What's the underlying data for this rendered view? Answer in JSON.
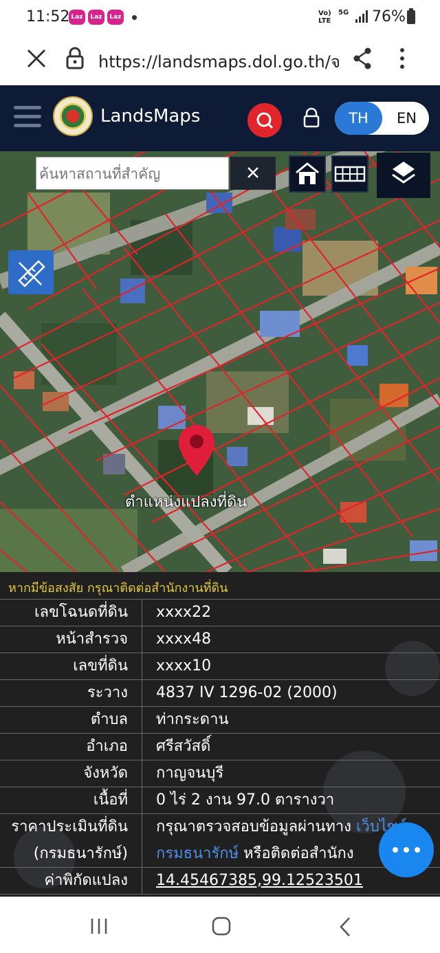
{
  "status": {
    "time": "11:52",
    "volte": "Vo) LTE",
    "network": "5G",
    "battery": "76%"
  },
  "browser": {
    "url": "https://landsmaps.dol.go.th/จ"
  },
  "header": {
    "brand": "LandsMaps",
    "lang_th": "TH",
    "lang_en": "EN"
  },
  "map": {
    "search_placeholder": "ค้นหาสถานที่สำคัญ",
    "pin_label": "ตำแหน่งแปลงที่ดิน"
  },
  "info": {
    "notice": "หากมีข้อสงสัย กรุณาติดต่อสำนักงานที่ดิน",
    "rows": [
      {
        "label": "เลขโฉนดที่ดิน",
        "value": "xxxx22"
      },
      {
        "label": "หน้าสำรวจ",
        "value": "xxxx48"
      },
      {
        "label": "เลขที่ดิน",
        "value": "xxxx10"
      },
      {
        "label": "ระวาง",
        "value": "4837 IV 1296-02 (2000)"
      },
      {
        "label": "ตำบล",
        "value": "ท่ากระดาน"
      },
      {
        "label": "อำเภอ",
        "value": "ศรีสวัสดิ์"
      },
      {
        "label": "จังหวัด",
        "value": "กาญจนบุรี"
      },
      {
        "label": "เนื้อที่",
        "value": "0 ไร่ 2 งาน 97.0 ตารางวา"
      }
    ],
    "appraisal": {
      "label_line1": "ราคาประเมินที่ดิน",
      "label_line2": "(กรมธนารักษ์)",
      "text1": "กรุณาตรวจสอบข้อมูลผ่านทาง",
      "link1": "เว็บไซต์",
      "link2": "กรมธนารักษ์",
      "text2": "หรือติดต่อสำนักง"
    },
    "coord_label": "ค่าพิกัดแปลง",
    "coord_value": "14.45467385,99.12523501"
  },
  "icons": {
    "accent_blue": "#1a86f0",
    "search_red": "#e0262b",
    "header_bg": "#0e1b36"
  }
}
